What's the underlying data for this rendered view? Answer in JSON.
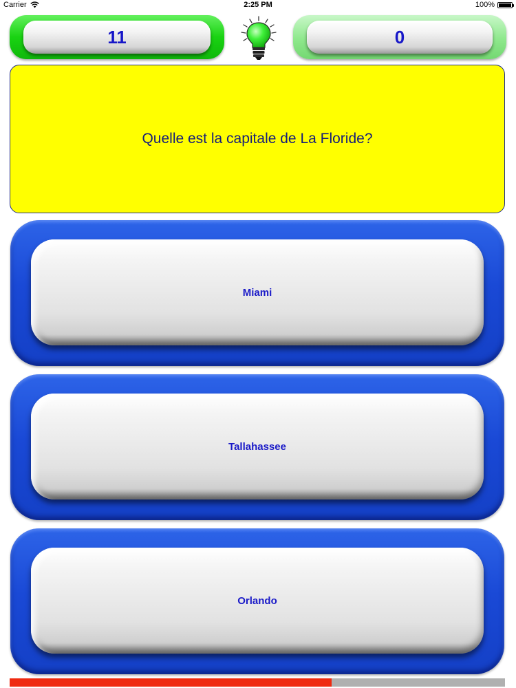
{
  "status_bar": {
    "carrier": "Carrier",
    "time": "2:25 PM",
    "battery": "100%",
    "icons": [
      "wifi-icon",
      "battery-icon"
    ]
  },
  "scores": {
    "correct": "11",
    "wrong": "0"
  },
  "hint": {
    "icon": "lightbulb-icon"
  },
  "question": {
    "text": "Quelle est la capitale de La Floride?"
  },
  "answers": [
    {
      "label": "Miami"
    },
    {
      "label": "Tallahassee"
    },
    {
      "label": "Orlando"
    }
  ],
  "progress": {
    "fraction": 0.65
  },
  "colors": {
    "question_bg": "#ffff00",
    "answer_frame": "#1a49d6",
    "answer_text": "#1a1ac8",
    "score_text": "#1717c8",
    "progress_fill": "#ef2a10",
    "progress_track": "#b0b0b0",
    "bulb": "#22e022"
  }
}
